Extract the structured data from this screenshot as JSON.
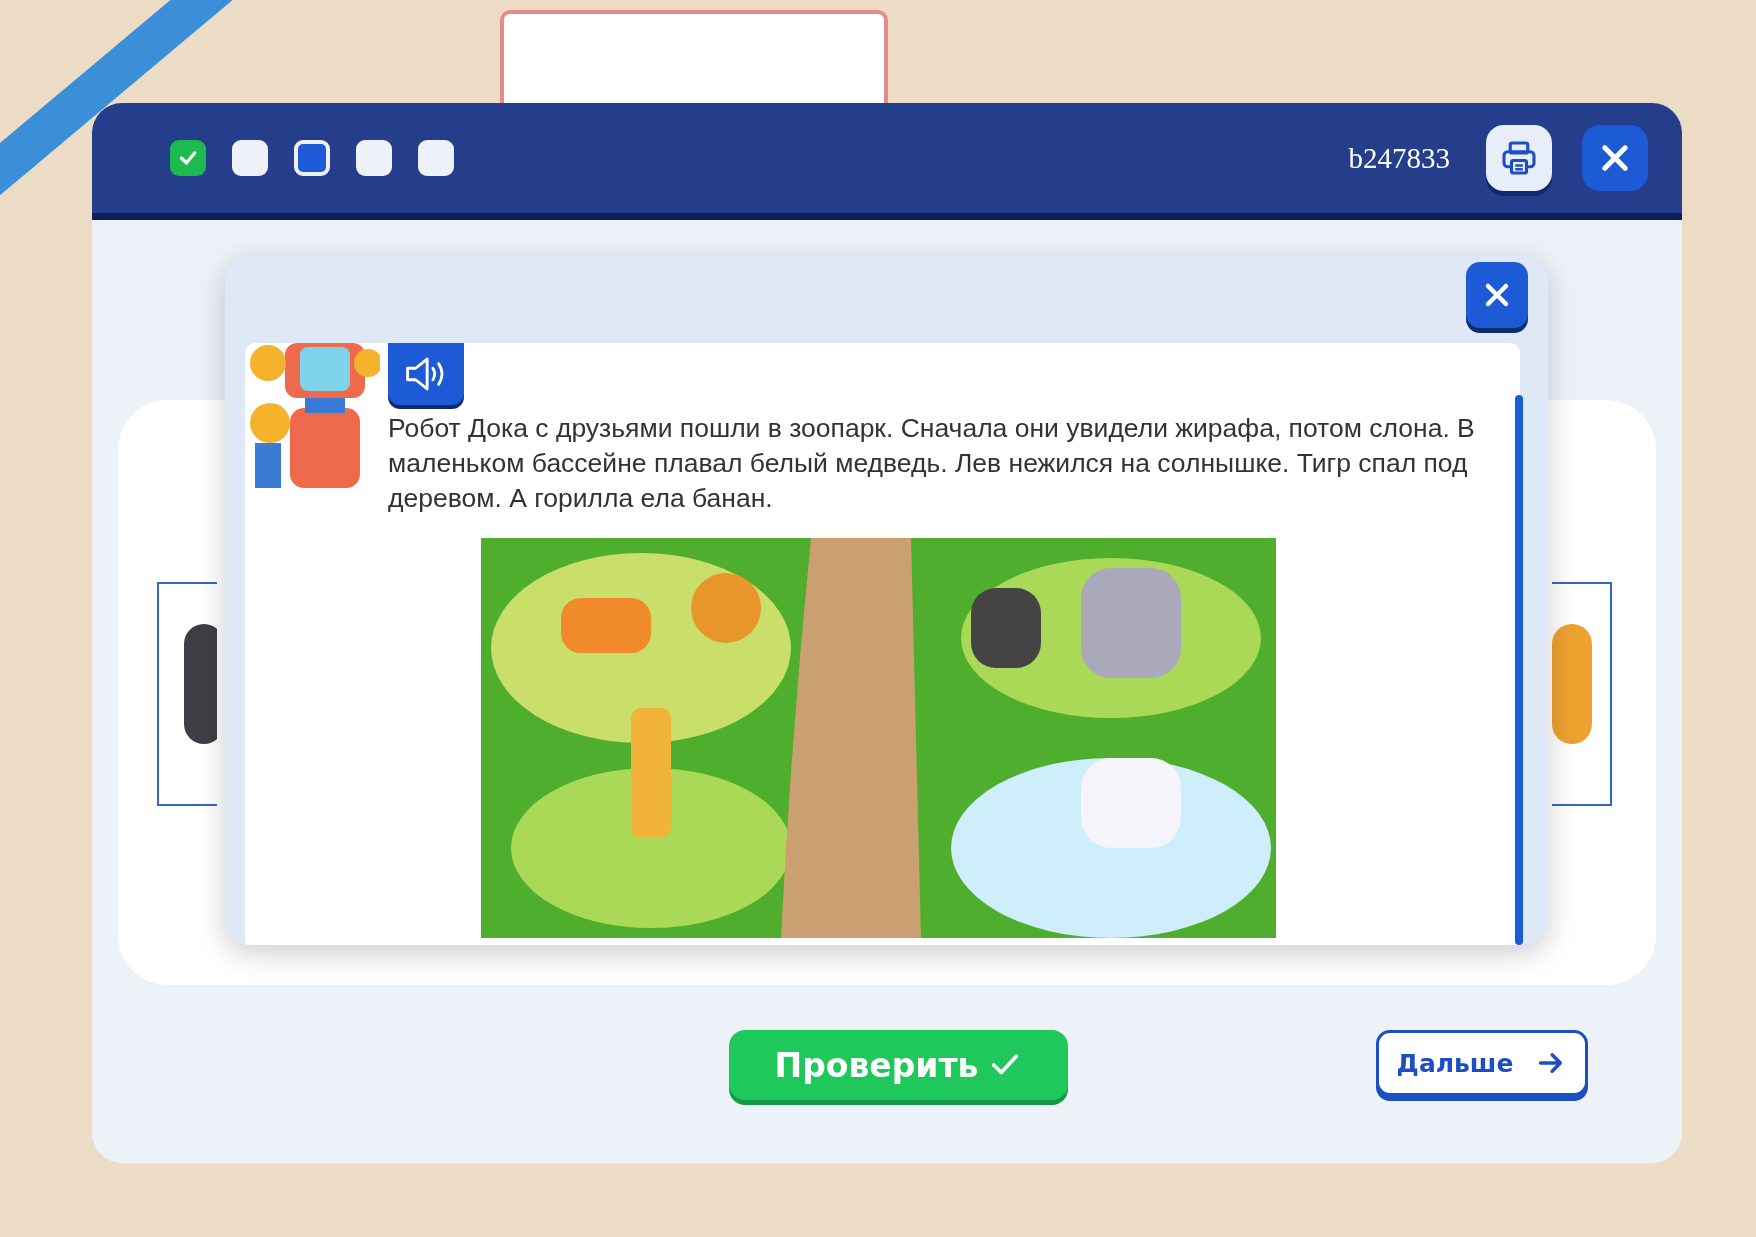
{
  "header": {
    "steps": [
      {
        "checked": true,
        "selected": false
      },
      {
        "checked": false,
        "selected": false
      },
      {
        "checked": false,
        "selected": true
      },
      {
        "checked": false,
        "selected": false
      },
      {
        "checked": false,
        "selected": false
      }
    ],
    "task_id": "b247833"
  },
  "popup": {
    "text": "Робот Дока с друзьями пошли в зоопарк. Сначала они увидели жирафа, потом слона. В маленьком бассейне плавал белый медведь. Лев нежился на солнышке. Тигр спал под деревом. А горилла ела банан."
  },
  "buttons": {
    "check": "Проверить",
    "next": "Дальше"
  }
}
